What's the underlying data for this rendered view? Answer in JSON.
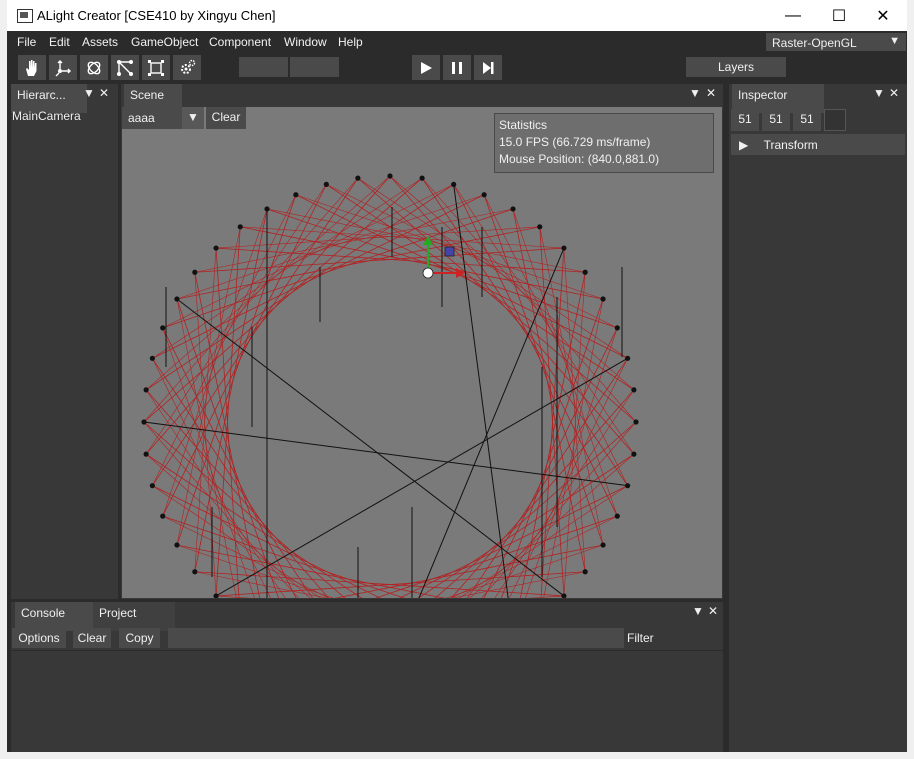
{
  "window": {
    "title": "ALight Creator [CSE410 by Xingyu Chen]",
    "minimize": "—",
    "maximize": "☐",
    "close": "✕"
  },
  "menubar": {
    "items": [
      "File",
      "Edit",
      "Assets",
      "GameObject",
      "Component",
      "Window",
      "Help"
    ],
    "renderer": "Raster-OpenGL",
    "renderer_caret": "▼"
  },
  "toolbar": {
    "tools": [
      "hand-tool-icon",
      "move-tool-icon",
      "rotate-tool-icon",
      "scale-tool-icon",
      "rect-tool-icon",
      "settings-tool-icon"
    ],
    "play": "▶",
    "pause": "❚❚",
    "step": "▶|",
    "layers": "Layers"
  },
  "hierarchy": {
    "tab": "Hierarc...",
    "items": [
      "MainCamera"
    ]
  },
  "scene": {
    "tab": "Scene",
    "select_value": "aaaa",
    "clear": "Clear",
    "stats": {
      "title": "Statistics",
      "fps": "15.0 FPS (66.729 ms/frame)",
      "mouse": "Mouse Position: (840.0,881.0)"
    }
  },
  "inspector": {
    "tab": "Inspector",
    "values": [
      "51",
      "51",
      "51"
    ],
    "component": "Transform"
  },
  "console": {
    "tabs": [
      "Console",
      "Project"
    ],
    "buttons": [
      "Options",
      "Clear",
      "Copy"
    ],
    "filter_label": "Filter"
  },
  "colors": {
    "bg": "#383838",
    "viewport": "#7a7a7a",
    "string_lines": "#b22222",
    "gizmo_y": "#22aa22",
    "gizmo_x": "#cc2222",
    "gizmo_cube": "#4444aa"
  },
  "tab_tools": {
    "menu": "▼",
    "close": "✕"
  }
}
